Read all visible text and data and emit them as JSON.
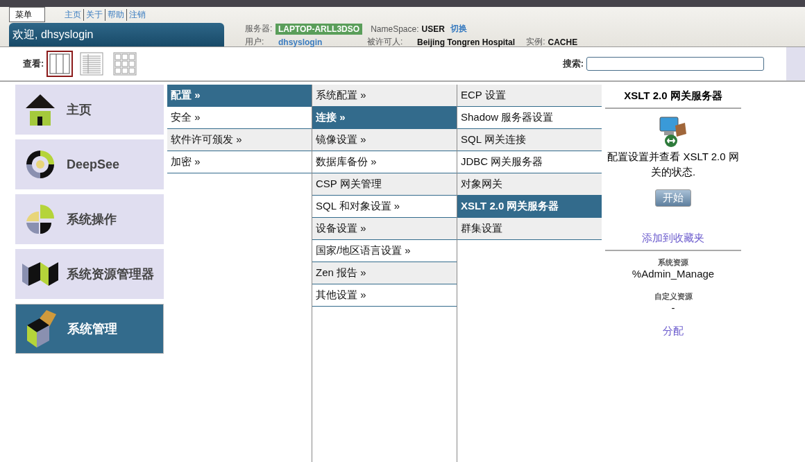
{
  "header": {
    "menu_button": "菜单",
    "links": [
      "主页",
      "关于",
      "帮助",
      "注销"
    ],
    "welcome": "欢迎, dhsyslogin",
    "info": {
      "server_label": "服务器:",
      "server": "LAPTOP-ARLL3DSO",
      "namespace_label": "NameSpace:",
      "namespace": "USER",
      "switch_link": "切换",
      "user_label": "用户:",
      "user": "dhsyslogin",
      "licensee_label": "被许可人:",
      "licensee": "Beijing Tongren Hospital",
      "instance_label": "实例:",
      "instance": "CACHE"
    }
  },
  "toolbar": {
    "view_label": "查看:",
    "views": [
      {
        "kind": "columns",
        "selected": true
      },
      {
        "kind": "list",
        "selected": false
      },
      {
        "kind": "grid",
        "selected": false
      }
    ],
    "search_label": "搜索:"
  },
  "nav": [
    {
      "label": "主页",
      "kind": "home",
      "selected": false
    },
    {
      "label": "DeepSee",
      "kind": "deepsee",
      "selected": false
    },
    {
      "label": "系统操作",
      "kind": "operations",
      "selected": false
    },
    {
      "label": "系统资源管理器",
      "kind": "explorer",
      "selected": false
    },
    {
      "label": "系统管理",
      "kind": "admin",
      "selected": true
    }
  ],
  "columns": [
    [
      {
        "label": "配置 »",
        "selected": true
      },
      {
        "label": "安全 »",
        "selected": false
      },
      {
        "label": "软件许可颁发 »",
        "selected": false
      },
      {
        "label": "加密 »",
        "selected": false
      }
    ],
    [
      {
        "label": "系统配置 »",
        "selected": false
      },
      {
        "label": "连接 »",
        "selected": true
      },
      {
        "label": "镜像设置 »",
        "selected": false
      },
      {
        "label": "数据库备份 »",
        "selected": false
      },
      {
        "label": "CSP 网关管理",
        "selected": false
      },
      {
        "label": "SQL 和对象设置 »",
        "selected": false
      },
      {
        "label": "设备设置 »",
        "selected": false
      },
      {
        "label": "国家/地区语言设置 »",
        "selected": false
      },
      {
        "label": "Zen 报告 »",
        "selected": false
      },
      {
        "label": "其他设置 »",
        "selected": false
      }
    ],
    [
      {
        "label": "ECP 设置",
        "selected": false
      },
      {
        "label": "Shadow 服务器设置",
        "selected": false
      },
      {
        "label": "SQL 网关连接",
        "selected": false
      },
      {
        "label": "JDBC 网关服务器",
        "selected": false
      },
      {
        "label": "对象网关",
        "selected": false
      },
      {
        "label": "XSLT 2.0 网关服务器",
        "selected": true
      },
      {
        "label": "群集设置",
        "selected": false
      }
    ]
  ],
  "detail": {
    "title": "XSLT 2.0 网关服务器",
    "description": "配置设置并查看 XSLT 2.0 网关的状态.",
    "start_button": "开始",
    "favorite_link": "添加到收藏夹",
    "system_resource_label": "系统资源",
    "system_resource": "%Admin_Manage",
    "custom_resource_label": "自定义资源",
    "custom_resource": "-",
    "assign_link": "分配"
  }
}
